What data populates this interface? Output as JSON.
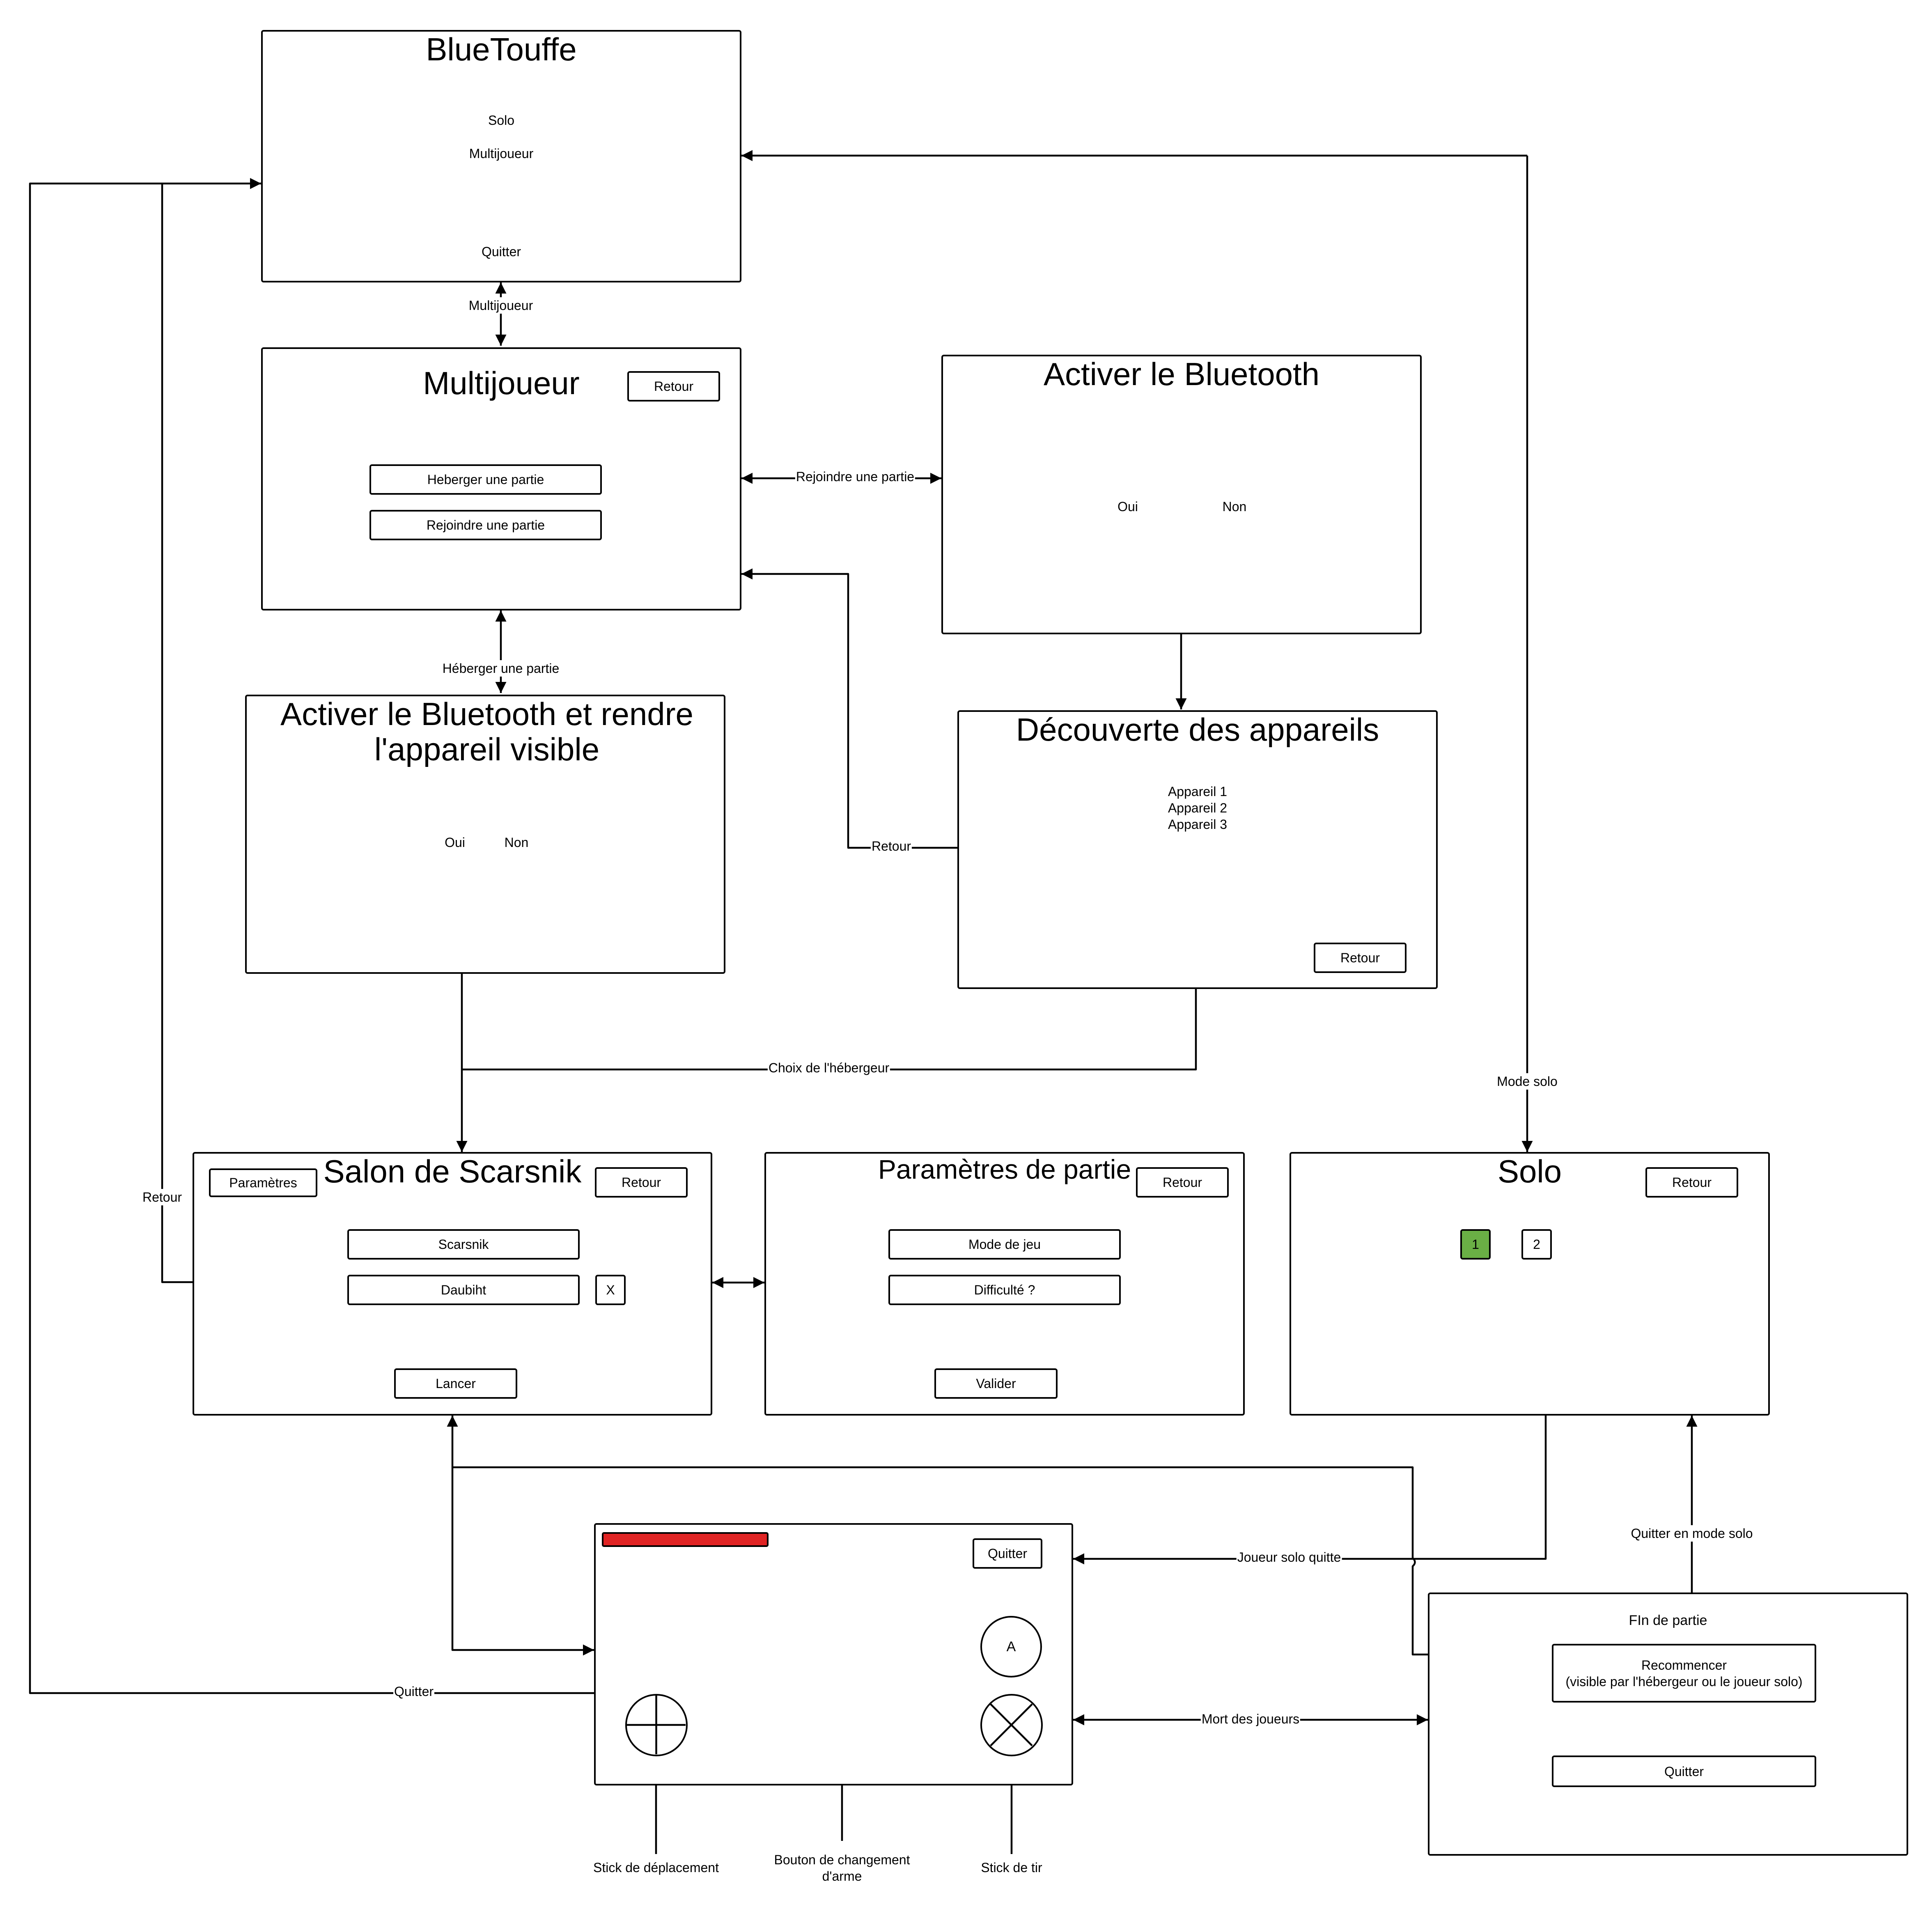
{
  "colors": {
    "stroke": "#000000",
    "healthbar": "#e02424",
    "selected_slot": "#6aaf45"
  },
  "screens": {
    "home": {
      "title": "BlueTouffe",
      "items": [
        "Solo",
        "Multijoueur"
      ],
      "quit": "Quitter"
    },
    "multi": {
      "title": "Multijoueur",
      "back": "Retour",
      "host": "Heberger une partie",
      "join": "Rejoindre une partie"
    },
    "bt_join": {
      "title": "Activer le Bluetooth",
      "yes": "Oui",
      "no": "Non"
    },
    "bt_host": {
      "title": "Activer le Bluetooth et rendre l'appareil visible",
      "yes": "Oui",
      "no": "Non"
    },
    "discovery": {
      "title": "Découverte des appareils",
      "devices": [
        "Appareil 1",
        "Appareil 2",
        "Appareil 3"
      ],
      "back": "Retour"
    },
    "lobby": {
      "title": "Salon de Scarsnik",
      "settings": "Paramètres",
      "back": "Retour",
      "player1": "Scarsnik",
      "player2": "Daubiht",
      "kick": "X",
      "launch": "Lancer"
    },
    "game_settings": {
      "title": "Paramètres de partie",
      "back": "Retour",
      "mode": "Mode de jeu",
      "difficulty": "Difficulté ?",
      "validate": "Valider"
    },
    "solo": {
      "title": "Solo",
      "back": "Retour",
      "slot1": "1",
      "slot2": "2"
    },
    "game": {
      "quit": "Quitter",
      "a_button": "A",
      "health_icon": "health-bar",
      "move_icon": "crosshair-stick-icon",
      "fire_icon": "x-stick-icon"
    },
    "end": {
      "title": "FIn de partie",
      "restart_line1": "Recommencer",
      "restart_line2": "(visible par l'hébergeur ou le joueur solo)",
      "quit": "Quitter"
    }
  },
  "arrows": {
    "home_multi": "Multijoueur",
    "multi_bt_join": "Rejoindre une partie",
    "multi_bt_host": "Héberger une partie",
    "discovery_back": "Retour",
    "host_choice": "Choix de l'hébergeur",
    "lobby_back": "Retour",
    "solo_mode": "Mode solo",
    "game_quit": "Quitter",
    "solo_quit": "Joueur solo quitte",
    "players_dead": "Mort des joueurs",
    "end_quit_solo": "Quitter en mode solo"
  },
  "annotations": {
    "move_stick": "Stick de déplacement",
    "weapon_switch": "Bouton de changement d'arme",
    "fire_stick": "Stick de tir"
  }
}
